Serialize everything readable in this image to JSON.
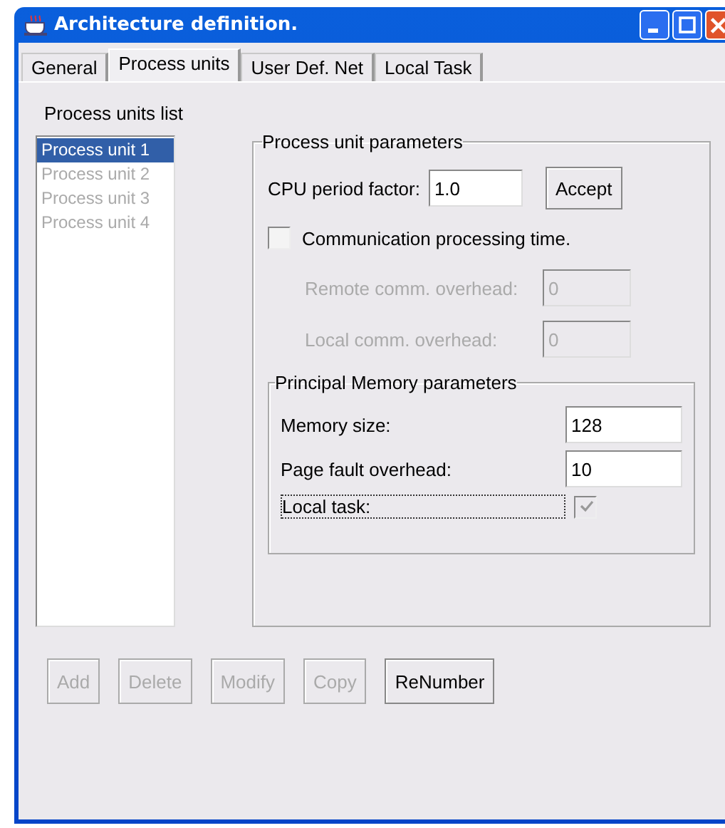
{
  "window": {
    "title": "Architecture definition."
  },
  "tabs": [
    {
      "label": "General",
      "selected": false
    },
    {
      "label": "Process units",
      "selected": true
    },
    {
      "label": "User Def. Net",
      "selected": false
    },
    {
      "label": "Local Task",
      "selected": false
    }
  ],
  "list": {
    "label": "Process units list",
    "items": [
      {
        "label": "Process unit 1",
        "selected": true,
        "disabled": false
      },
      {
        "label": "Process unit 2",
        "selected": false,
        "disabled": true
      },
      {
        "label": "Process unit 3",
        "selected": false,
        "disabled": true
      },
      {
        "label": "Process unit 4",
        "selected": false,
        "disabled": true
      }
    ]
  },
  "parameters": {
    "title": "Process unit parameters",
    "cpu": {
      "label": "CPU period factor:",
      "value": "1.0"
    },
    "accept": "Accept",
    "communication": {
      "label": "Communication processing time.",
      "checked": false
    },
    "comm_fields": [
      {
        "label": "Remote comm. overhead:",
        "value": "0",
        "disabled": true
      },
      {
        "label": "Local comm. overhead:",
        "value": "0",
        "disabled": true
      }
    ],
    "memory": {
      "title": "Principal Memory parameters",
      "fields": [
        {
          "label": "Memory size:",
          "value": "128"
        },
        {
          "label": "Page fault overhead:",
          "value": "10"
        }
      ],
      "local_task": {
        "label": "Local task:",
        "checked": true,
        "disabled": true
      }
    }
  },
  "buttons": [
    {
      "label": "Add",
      "disabled": true
    },
    {
      "label": "Delete",
      "disabled": true
    },
    {
      "label": "Modify",
      "disabled": true
    },
    {
      "label": "Copy",
      "disabled": true
    },
    {
      "label": "ReNumber",
      "disabled": false
    }
  ]
}
